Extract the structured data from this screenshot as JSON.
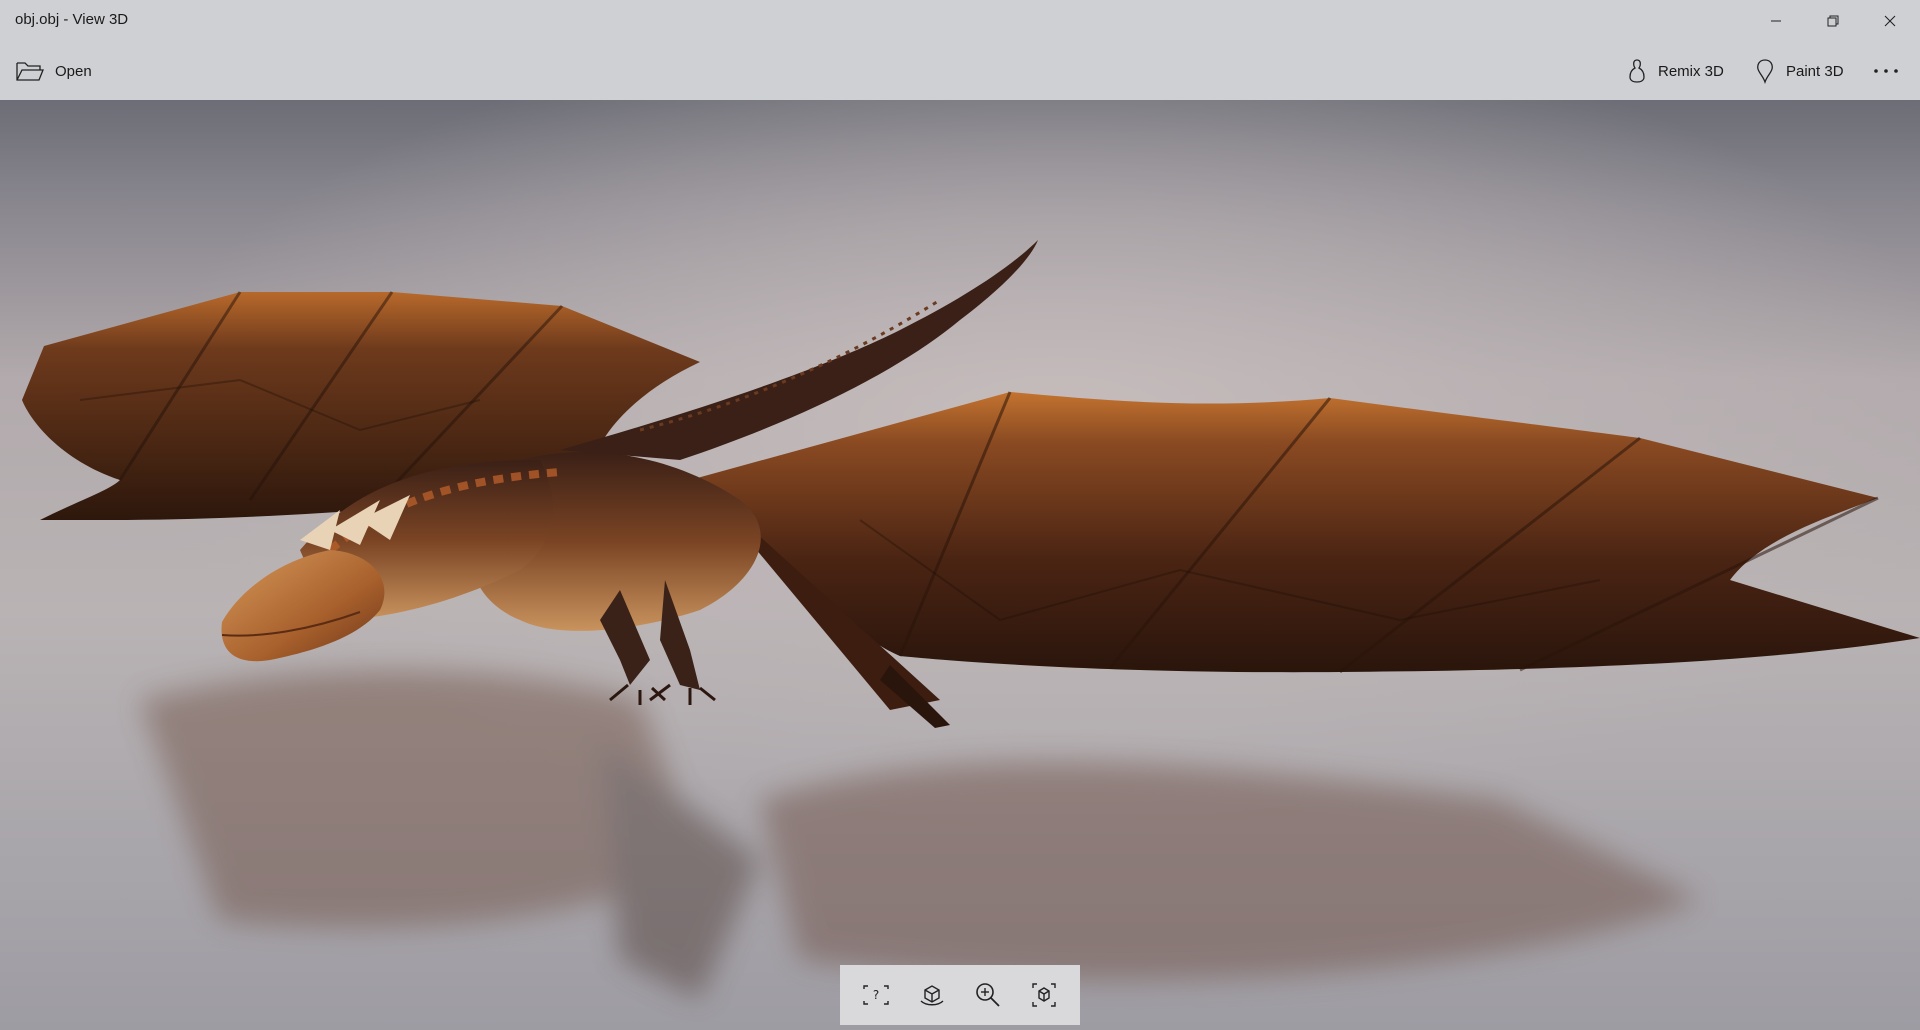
{
  "window": {
    "title": "obj.obj - View 3D"
  },
  "commandbar": {
    "open_label": "Open",
    "remix_label": "Remix 3D",
    "paint_label": "Paint 3D"
  },
  "icons": {
    "open": "folder-open-icon",
    "remix": "remix-3d-icon",
    "paint": "paint-3d-icon",
    "more": "more-icon",
    "minimize": "minimize-icon",
    "maximize": "restore-icon",
    "close": "close-icon",
    "toolbar": [
      "help-frame-icon",
      "environment-icon",
      "zoom-icon",
      "reset-view-icon"
    ]
  },
  "colors": {
    "chrome": "#cfd0d4",
    "dragon_dark": "#3a1f12",
    "dragon_mid": "#7a3f1c",
    "dragon_light": "#c98a4a"
  }
}
